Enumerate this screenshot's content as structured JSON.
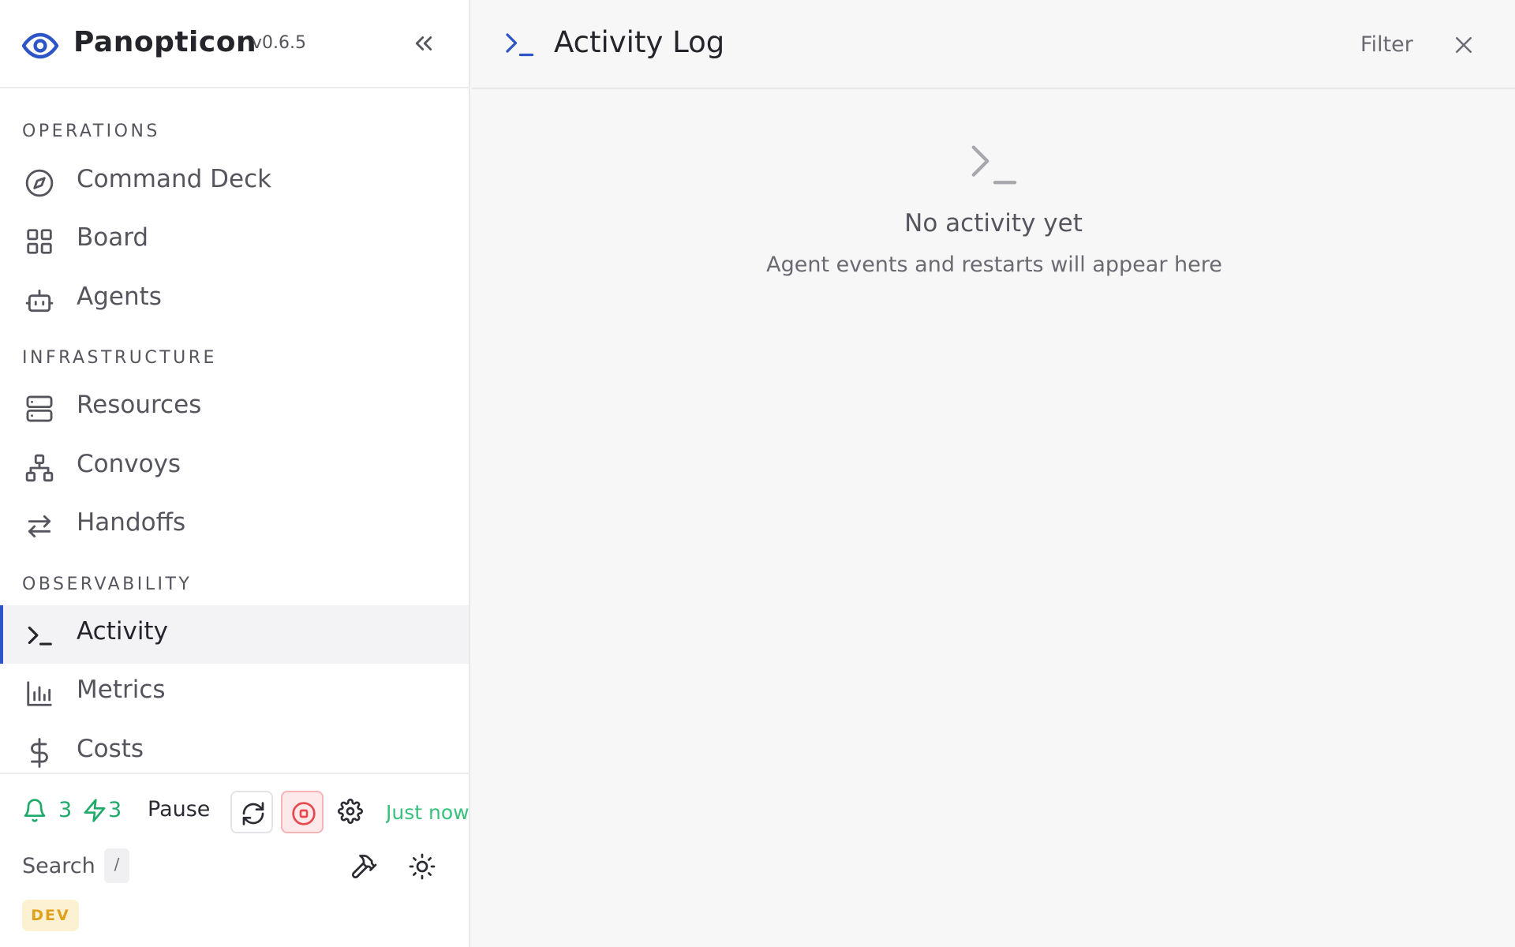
{
  "app": {
    "name": "Panopticon",
    "version": "v0.6.5"
  },
  "sidebar": {
    "sections": [
      {
        "title": "OPERATIONS",
        "items": [
          {
            "label": "Command Deck",
            "icon": "compass-icon"
          },
          {
            "label": "Board",
            "icon": "grid-icon"
          },
          {
            "label": "Agents",
            "icon": "robot-icon"
          }
        ]
      },
      {
        "title": "INFRASTRUCTURE",
        "items": [
          {
            "label": "Resources",
            "icon": "server-icon"
          },
          {
            "label": "Convoys",
            "icon": "network-icon"
          },
          {
            "label": "Handoffs",
            "icon": "arrows-swap-icon"
          }
        ]
      },
      {
        "title": "OBSERVABILITY",
        "items": [
          {
            "label": "Activity",
            "icon": "terminal-icon",
            "active": true
          },
          {
            "label": "Metrics",
            "icon": "bar-chart-icon"
          },
          {
            "label": "Costs",
            "icon": "dollar-icon"
          }
        ]
      }
    ]
  },
  "footer": {
    "notifications_count": "3",
    "bolt_count": "3",
    "pause_label": "Pause",
    "last_updated": "Just now",
    "search_label": "Search",
    "search_shortcut": "/",
    "env_badge": "DEV"
  },
  "main": {
    "title": "Activity Log",
    "filter_label": "Filter",
    "empty_title": "No activity yet",
    "empty_subtitle": "Agent events and restarts will appear here"
  },
  "colors": {
    "accent": "#2d55c8",
    "success": "#1faa6a",
    "danger": "#e5484d",
    "warning": "#e0a019"
  }
}
